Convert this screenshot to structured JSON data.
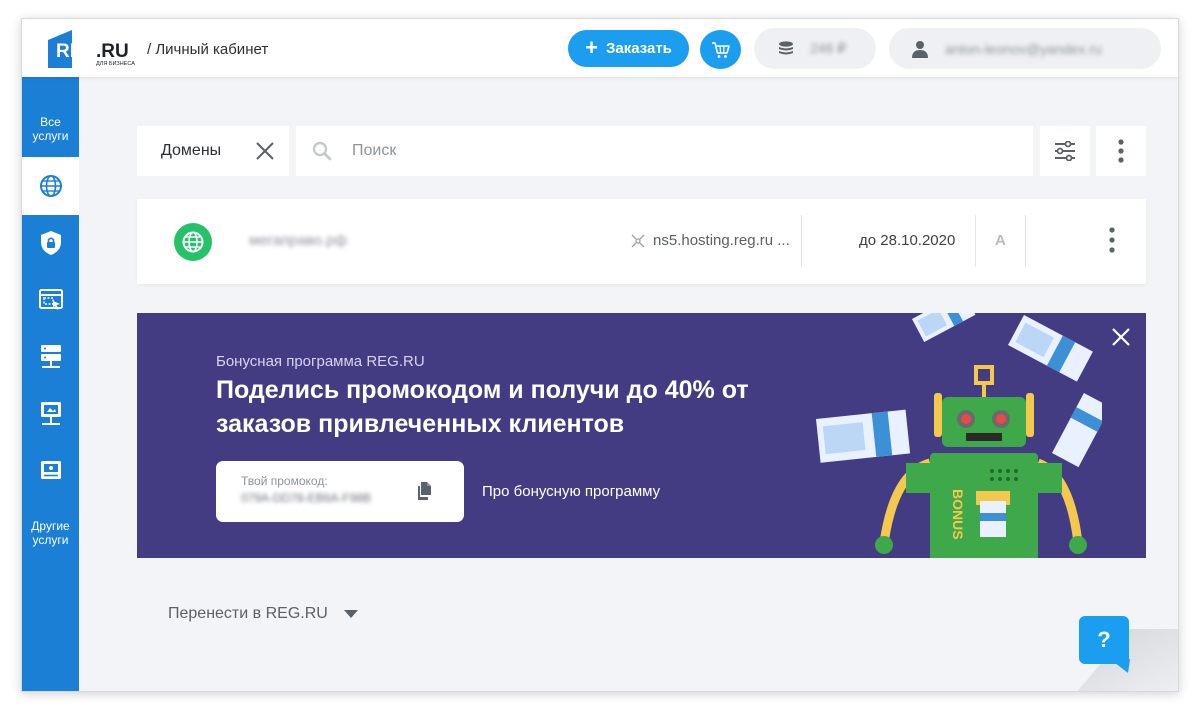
{
  "header": {
    "logo_text": "REG.RU",
    "logo_sub": "ДЛЯ БИЗНЕСА",
    "breadcrumb": "/ Личный кабинет",
    "order_label": "Заказать",
    "balance": "246 ₽",
    "user_email": "anton-leonov@yandex.ru"
  },
  "sidebar": {
    "all_services": "Все услуги",
    "other_services": "Другие услуги",
    "items": [
      {
        "icon": "globe-icon",
        "active": true
      },
      {
        "icon": "shield-lock-icon",
        "active": false
      },
      {
        "icon": "website-builder-icon",
        "active": false
      },
      {
        "icon": "server-icon",
        "active": false
      },
      {
        "icon": "vps-icon",
        "active": false
      },
      {
        "icon": "hosting-icon",
        "active": false
      }
    ]
  },
  "toolbar": {
    "filter_chip": "Домены",
    "search_placeholder": "Поиск"
  },
  "domains": [
    {
      "name": "мегаправо.рф",
      "nameservers": "ns5.hosting.reg.ru ...",
      "expires": "до 28.10.2020",
      "status_letter": "А"
    }
  ],
  "banner": {
    "kicker": "Бонусная программа REG.RU",
    "headline": "Поделись промокодом и получи до 40% от заказов привлеченных клиентов",
    "promo_label": "Твой промокод:",
    "promo_code": "079A-DD78-EB6A-F98B",
    "link": "Про бонусную программу",
    "robot_text": "BONUS"
  },
  "footer": {
    "transfer": "Перенести в REG.RU"
  },
  "help": {
    "label": "?"
  },
  "colors": {
    "accent": "#1b9ef0",
    "sidebar": "#1b7fd6",
    "banner": "#433c83",
    "domain_green": "#27c16a"
  }
}
